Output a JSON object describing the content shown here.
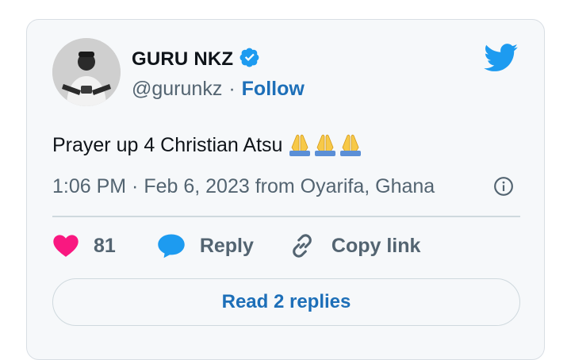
{
  "tweet": {
    "author_name": "GURU NKZ",
    "handle": "@gurunkz",
    "separator": "·",
    "follow_label": "Follow",
    "text": "Prayer up 4 Christian Atsu",
    "emoji": "🙏🙏🙏",
    "timestamp": "1:06 PM · Feb 6, 2023 from Oyarifa, Ghana"
  },
  "actions": {
    "likes_count": "81",
    "reply_label": "Reply",
    "copy_link_label": "Copy link"
  },
  "read_replies_label": "Read 2 replies",
  "colors": {
    "verified": "#1d9bf0",
    "twitter_blue": "#1d9bf0",
    "link": "#1d6fb8",
    "heart": "#f91880",
    "muted": "#536471"
  }
}
